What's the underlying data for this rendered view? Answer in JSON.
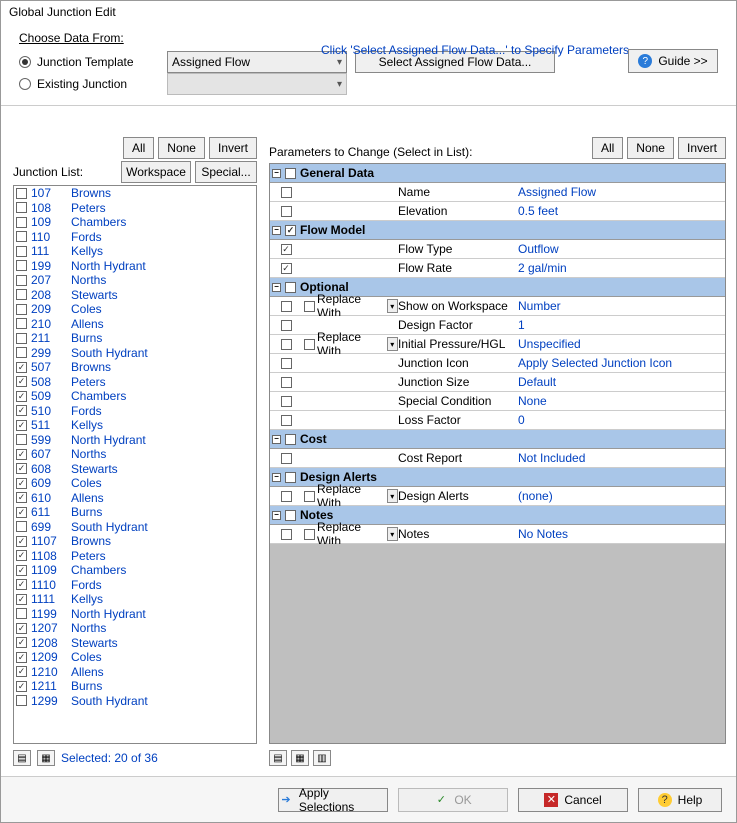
{
  "window": {
    "title": "Global Junction Edit"
  },
  "top": {
    "choose_label": "Choose Data From:",
    "r1": "Junction Template",
    "r2": "Existing Junction",
    "template_sel": "Assigned Flow",
    "assign_btn": "Select Assigned Flow Data...",
    "hint": "Click 'Select Assigned Flow Data...' to Specify Parameters",
    "guide": "Guide >>"
  },
  "left": {
    "all": "All",
    "none": "None",
    "invert": "Invert",
    "workspace": "Workspace",
    "special": "Special...",
    "list_label": "Junction List:",
    "selected": "Selected: 20 of 36"
  },
  "junctions": [
    {
      "id": "107",
      "name": "Browns",
      "c": false
    },
    {
      "id": "108",
      "name": "Peters",
      "c": false
    },
    {
      "id": "109",
      "name": "Chambers",
      "c": false
    },
    {
      "id": "110",
      "name": "Fords",
      "c": false
    },
    {
      "id": "111",
      "name": "Kellys",
      "c": false
    },
    {
      "id": "199",
      "name": "North Hydrant",
      "c": false
    },
    {
      "id": "207",
      "name": "Norths",
      "c": false
    },
    {
      "id": "208",
      "name": "Stewarts",
      "c": false
    },
    {
      "id": "209",
      "name": "Coles",
      "c": false
    },
    {
      "id": "210",
      "name": "Allens",
      "c": false
    },
    {
      "id": "211",
      "name": "Burns",
      "c": false
    },
    {
      "id": "299",
      "name": "South Hydrant",
      "c": false
    },
    {
      "id": "507",
      "name": "Browns",
      "c": true
    },
    {
      "id": "508",
      "name": "Peters",
      "c": true
    },
    {
      "id": "509",
      "name": "Chambers",
      "c": true
    },
    {
      "id": "510",
      "name": "Fords",
      "c": true
    },
    {
      "id": "511",
      "name": "Kellys",
      "c": true
    },
    {
      "id": "599",
      "name": "North Hydrant",
      "c": false
    },
    {
      "id": "607",
      "name": "Norths",
      "c": true
    },
    {
      "id": "608",
      "name": "Stewarts",
      "c": true
    },
    {
      "id": "609",
      "name": "Coles",
      "c": true
    },
    {
      "id": "610",
      "name": "Allens",
      "c": true
    },
    {
      "id": "611",
      "name": "Burns",
      "c": true
    },
    {
      "id": "699",
      "name": "South Hydrant",
      "c": false
    },
    {
      "id": "1107",
      "name": "Browns",
      "c": true
    },
    {
      "id": "1108",
      "name": "Peters",
      "c": true
    },
    {
      "id": "1109",
      "name": "Chambers",
      "c": true
    },
    {
      "id": "1110",
      "name": "Fords",
      "c": true
    },
    {
      "id": "1111",
      "name": "Kellys",
      "c": true
    },
    {
      "id": "1199",
      "name": "North Hydrant",
      "c": false
    },
    {
      "id": "1207",
      "name": "Norths",
      "c": true
    },
    {
      "id": "1208",
      "name": "Stewarts",
      "c": true
    },
    {
      "id": "1209",
      "name": "Coles",
      "c": true
    },
    {
      "id": "1210",
      "name": "Allens",
      "c": true
    },
    {
      "id": "1211",
      "name": "Burns",
      "c": true
    },
    {
      "id": "1299",
      "name": "South Hydrant",
      "c": false
    }
  ],
  "right": {
    "header": "Parameters to Change (Select in List):",
    "all": "All",
    "none": "None",
    "invert": "Invert",
    "replace_with": "Replace With"
  },
  "sections": [
    {
      "title": "General Data",
      "c": false,
      "rows": [
        {
          "c": false,
          "repl": "",
          "name": "Name",
          "val": "Assigned Flow"
        },
        {
          "c": false,
          "repl": "",
          "name": "Elevation",
          "val": "0.5 feet"
        }
      ]
    },
    {
      "title": "Flow Model",
      "c": true,
      "rows": [
        {
          "c": true,
          "repl": "",
          "name": "Flow Type",
          "val": "Outflow"
        },
        {
          "c": true,
          "repl": "",
          "name": "Flow Rate",
          "val": "2 gal/min"
        }
      ]
    },
    {
      "title": "Optional",
      "c": false,
      "rows": [
        {
          "c": false,
          "repl": "dd",
          "name": "Show on Workspace",
          "val": "Number"
        },
        {
          "c": false,
          "repl": "",
          "name": "Design Factor",
          "val": "1"
        },
        {
          "c": false,
          "repl": "dd",
          "name": "Initial Pressure/HGL",
          "val": "Unspecified"
        },
        {
          "c": false,
          "repl": "",
          "name": "Junction Icon",
          "val": "Apply Selected Junction Icon"
        },
        {
          "c": false,
          "repl": "",
          "name": "Junction Size",
          "val": "Default"
        },
        {
          "c": false,
          "repl": "",
          "name": "Special Condition",
          "val": "None"
        },
        {
          "c": false,
          "repl": "",
          "name": "Loss Factor",
          "val": "0"
        }
      ]
    },
    {
      "title": "Cost",
      "c": false,
      "rows": [
        {
          "c": false,
          "repl": "",
          "name": "Cost Report",
          "val": "Not Included"
        }
      ]
    },
    {
      "title": "Design Alerts",
      "c": false,
      "rows": [
        {
          "c": false,
          "repl": "dd",
          "name": "Design Alerts",
          "val": "(none)"
        }
      ]
    },
    {
      "title": "Notes",
      "c": false,
      "rows": [
        {
          "c": false,
          "repl": "dd",
          "name": "Notes",
          "val": "No Notes"
        }
      ]
    }
  ],
  "footer": {
    "apply": "Apply Selections",
    "ok": "OK",
    "cancel": "Cancel",
    "help": "Help"
  }
}
